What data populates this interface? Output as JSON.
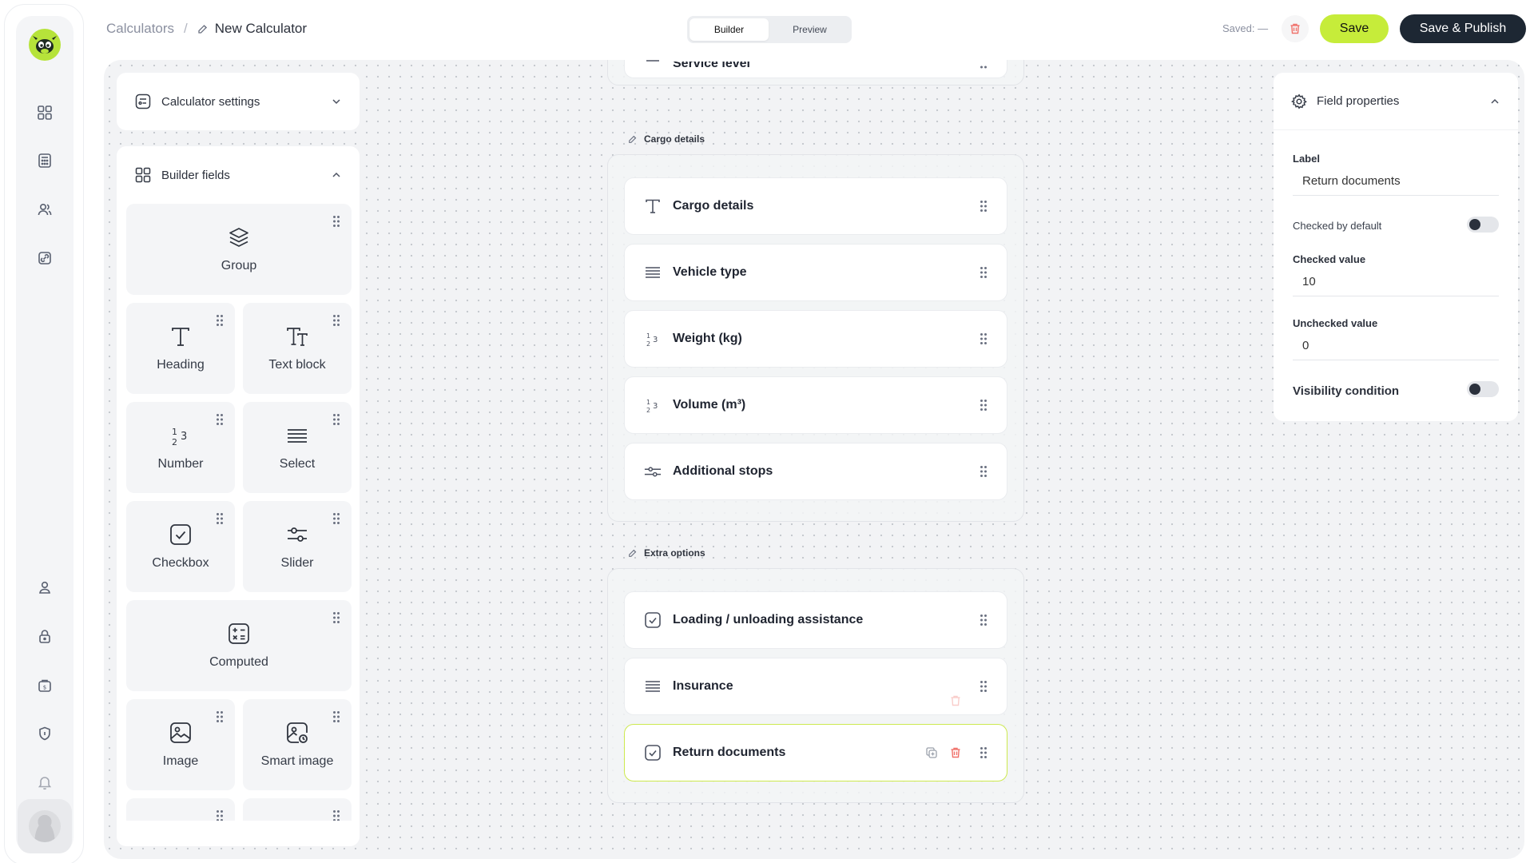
{
  "breadcrumb": {
    "parent": "Calculators",
    "separator": "/",
    "current": "New Calculator"
  },
  "modes": {
    "builder": "Builder",
    "preview": "Preview",
    "active": "Builder"
  },
  "header": {
    "saved_status": "Saved: —",
    "save_label": "Save",
    "publish_label": "Save & Publish"
  },
  "colors": {
    "accent": "#c6ec3a",
    "dark": "#1d2733",
    "danger": "#f0716a"
  },
  "rail": {
    "top_items": [
      "grid-icon",
      "calculator-icon",
      "users-icon",
      "links-icon"
    ],
    "bottom_items": [
      "user-icon",
      "lock-icon",
      "billing-icon",
      "shield-icon",
      "bell-icon"
    ]
  },
  "settings_panel": {
    "title": "Calculator settings"
  },
  "builder_panel": {
    "title": "Builder fields",
    "fields": [
      "Group",
      "Heading",
      "Text block",
      "Number",
      "Select",
      "Checkbox",
      "Slider",
      "Computed",
      "Image",
      "Smart image"
    ]
  },
  "canvas": {
    "top_group_partial_field": "Service level",
    "groups": [
      {
        "title": "Cargo details",
        "fields": [
          {
            "label": "Cargo details",
            "icon": "heading-icon"
          },
          {
            "label": "Vehicle type",
            "icon": "select-icon"
          },
          {
            "label": "Weight (kg)",
            "icon": "number-icon"
          },
          {
            "label": "Volume (m³)",
            "icon": "number-icon"
          },
          {
            "label": "Additional stops",
            "icon": "slider-icon"
          }
        ]
      },
      {
        "title": "Extra options",
        "fields": [
          {
            "label": "Loading / unloading assistance",
            "icon": "checkbox-icon"
          },
          {
            "label": "Insurance",
            "icon": "select-icon"
          },
          {
            "label": "Return documents",
            "icon": "checkbox-icon"
          }
        ]
      }
    ]
  },
  "properties": {
    "title": "Field properties",
    "label_title": "Label",
    "label_value": "Return documents",
    "checked_default_title": "Checked by default",
    "checked_default": false,
    "checked_value_title": "Checked value",
    "checked_value": "10",
    "unchecked_value_title": "Unchecked value",
    "unchecked_value": "0",
    "visibility_title": "Visibility condition",
    "visibility": false
  }
}
